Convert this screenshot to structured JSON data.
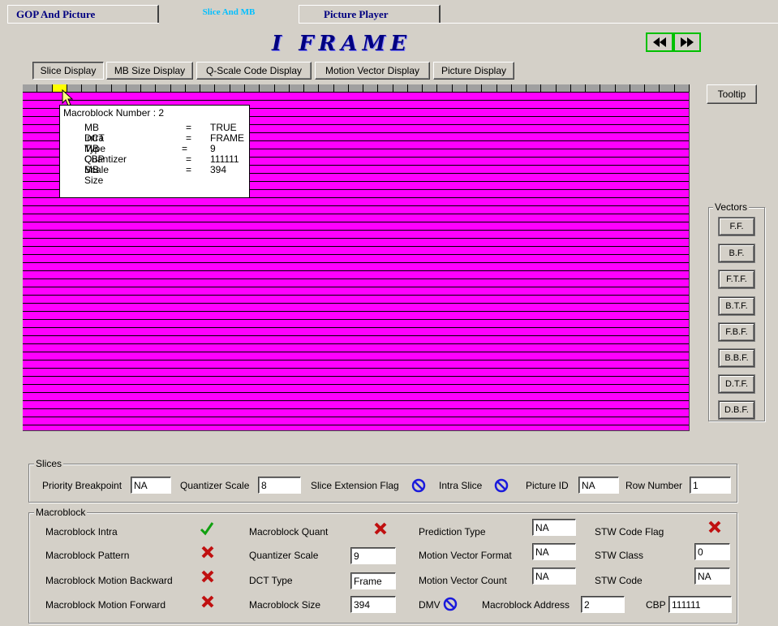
{
  "tabs": [
    {
      "label": "GOP  And  Picture"
    },
    {
      "label": "Slice  And  MB"
    },
    {
      "label": "Picture  Player"
    }
  ],
  "frame_title": "I FRAME",
  "nav": {
    "prev_icon": "rewind-icon",
    "next_icon": "fast-forward-icon"
  },
  "display_buttons": [
    {
      "label": "Slice Display"
    },
    {
      "label": "MB Size Display"
    },
    {
      "label": "Q-Scale Code Display"
    },
    {
      "label": "Motion Vector Display"
    },
    {
      "label": "Picture Display"
    }
  ],
  "tooltip_button": "Tooltip",
  "tooltip": {
    "heading": "Macroblock Number : 2",
    "rows": [
      {
        "key": "MB Intra",
        "eq": "=",
        "value": "TRUE"
      },
      {
        "key": "DCT Type",
        "eq": "=",
        "value": "FRAME"
      },
      {
        "key": "MB Quantizer Scale",
        "eq": "=",
        "value": "9"
      },
      {
        "key": "CBP",
        "eq": "=",
        "value": "111111"
      },
      {
        "key": "MB Size",
        "eq": "=",
        "value": "394"
      }
    ]
  },
  "vectors": {
    "title": "Vectors",
    "buttons": [
      "F.F.",
      "B.F.",
      "F.T.F.",
      "B.T.F.",
      "F.B.F.",
      "B.B.F.",
      "D.T.F.",
      "D.B.F."
    ]
  },
  "slices": {
    "title": "Slices",
    "priority_breakpoint_label": "Priority Breakpoint",
    "priority_breakpoint": "NA",
    "quantizer_scale_label": "Quantizer Scale",
    "quantizer_scale": "8",
    "slice_extension_flag_label": "Slice Extension Flag",
    "intra_slice_label": "Intra Slice",
    "picture_id_label": "Picture ID",
    "picture_id": "NA",
    "row_number_label": "Row Number",
    "row_number": "1"
  },
  "macroblock": {
    "title": "Macroblock",
    "intra_label": "Macroblock Intra",
    "pattern_label": "Macroblock Pattern",
    "motion_backward_label": "Macroblock Motion Backward",
    "motion_forward_label": "Macroblock Motion Forward",
    "quant_label": "Macroblock Quant",
    "quantizer_scale_label": "Quantizer Scale",
    "quantizer_scale": "9",
    "dct_type_label": "DCT Type",
    "dct_type": "Frame",
    "size_label": "Macroblock Size",
    "size": "394",
    "prediction_type_label": "Prediction Type",
    "prediction_type": "NA",
    "mv_format_label": "Motion Vector Format",
    "mv_format": "NA",
    "mv_count_label": "Motion Vector Count",
    "mv_count": "NA",
    "dmv_label": "DMV",
    "address_label": "Macroblock Address",
    "address": "2",
    "stw_code_flag_label": "STW Code Flag",
    "stw_class_label": "STW Class",
    "stw_class": "0",
    "stw_code_label": "STW Code",
    "stw_code": "NA",
    "cbp_label": "CBP",
    "cbp": "111111"
  },
  "colors": {
    "slice_fill": "#ff00ff",
    "selected_mb": "#ffff00",
    "title": "#000080"
  }
}
